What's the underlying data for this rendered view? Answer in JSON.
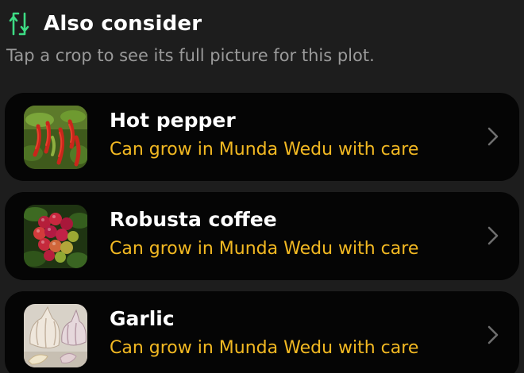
{
  "section": {
    "icon": "swap-vertical-icon",
    "title": "Also consider",
    "subtitle": "Tap a crop to see its full picture for this plot."
  },
  "crops": [
    {
      "name": "Hot pepper",
      "status": "Can grow in Munda Wedu with care",
      "thumb_icon": "hot-pepper-photo",
      "chevron_icon": "chevron-right-icon"
    },
    {
      "name": "Robusta coffee",
      "status": "Can grow in Munda Wedu with care",
      "thumb_icon": "robusta-coffee-photo",
      "chevron_icon": "chevron-right-icon"
    },
    {
      "name": "Garlic",
      "status": "Can grow in Munda Wedu with care",
      "thumb_icon": "garlic-photo",
      "chevron_icon": "chevron-right-icon"
    }
  ],
  "colors": {
    "background": "#1d1d1d",
    "card": "#050505",
    "title": "#ffffff",
    "subtitle": "#9a9a9a",
    "status": "#f3b922",
    "accent_icon": "#3ddc84",
    "chevron": "#6e6e6e"
  }
}
